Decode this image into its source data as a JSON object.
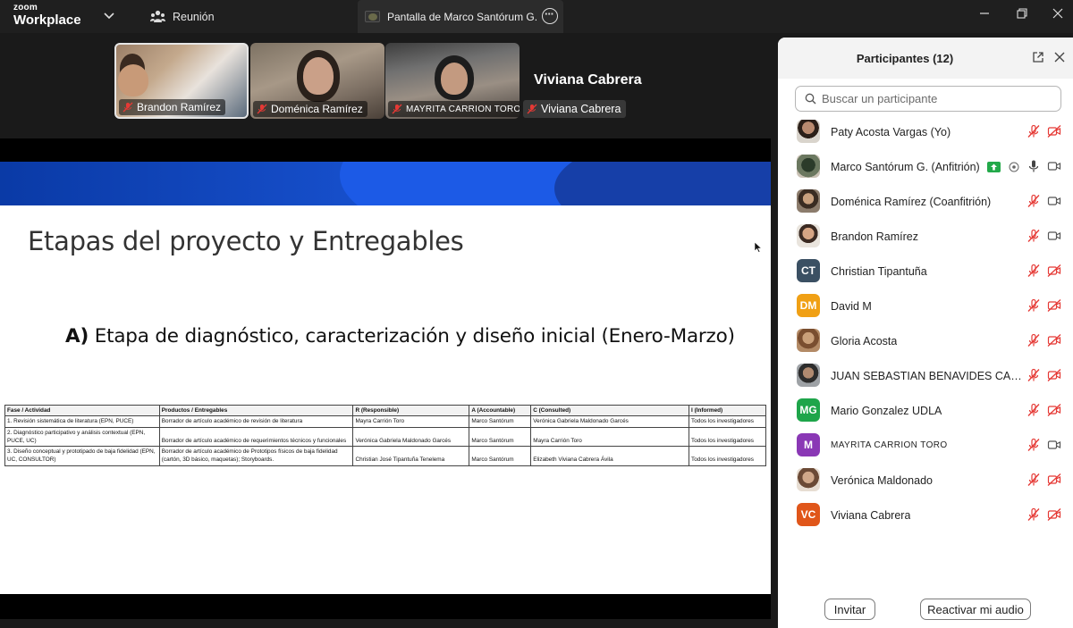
{
  "app": {
    "logo_line1": "zoom",
    "logo_line2": "Workplace",
    "meeting_tab_label": "Reunión",
    "share_tab_label": "Pantalla de Marco Santórum G."
  },
  "videos": [
    {
      "name": "Brandon Ramírez",
      "muted": true
    },
    {
      "name": "Doménica Ramírez",
      "muted": true
    },
    {
      "name": "MAYRITA CARRION TORO",
      "muted": true
    },
    {
      "name": "Viviana Cabrera",
      "muted": true
    }
  ],
  "active_speaker_name": "Viviana Cabrera",
  "slide": {
    "title": "Etapas del proyecto y Entregables",
    "subtitle_prefix": "A)",
    "subtitle": "Etapa de diagnóstico, caracterización y diseño inicial (Enero-Marzo)",
    "table": {
      "headers": [
        "Fase / Actividad",
        "Productos / Entregables",
        "R (Responsible)",
        "A (Accountable)",
        "C (Consulted)",
        "I (Informed)"
      ],
      "rows": [
        [
          "1. Revisión sistemática de literatura (EPN, PUCE)",
          "Borrador de artículo académico de revisión de literatura",
          "Mayra Carrión Toro",
          "Marco Santórum",
          "Verónica Gabriela Maldonado Garcés",
          "Todos los investigadores"
        ],
        [
          "2. Diagnóstico participativo y análisis contextual (EPN, PUCE, UC)",
          "Borrador de artículo académico de requerimientos técnicos y funcionales",
          "Verónica Gabriela Maldonado Garcés",
          "Marco Santórum",
          "Mayra Carrión Toro",
          "Todos los investigadores"
        ],
        [
          "3. Diseño conceptual y prototipado de baja fidelidad (EPN, UC, CONSULTOR)",
          "Borrador de artículo académico de Prototipos físicos de baja fidelidad (cartón, 3D básico, maquetas); Storyboards.",
          "Christian José Tipantuña Tenelema",
          "Marco Santórum",
          "Elizabeth Viviana Cabrera Ávila",
          "Todos los investigadores"
        ]
      ]
    }
  },
  "panel": {
    "title": "Participantes (12)",
    "search_placeholder": "Buscar un participante",
    "invite_label": "Invitar",
    "reactivate_label": "Reactivar mi audio",
    "participants": [
      {
        "name": "Paty Acosta Vargas (Yo)",
        "avatar": "photo",
        "mic": "muted",
        "cam": "off"
      },
      {
        "name": "Marco Santórum G. (Anfitrión)",
        "avatar": "photo",
        "mic": "on",
        "cam": "on",
        "sharing": true
      },
      {
        "name": "Doménica Ramírez (Coanfitrión)",
        "avatar": "photo",
        "mic": "muted",
        "cam": "on"
      },
      {
        "name": "Brandon Ramírez",
        "avatar": "photo",
        "mic": "muted",
        "cam": "on"
      },
      {
        "name": "Christian Tipantuña",
        "avatar": "CT",
        "avatar_color": "#3b5063",
        "mic": "muted",
        "cam": "off"
      },
      {
        "name": "David M",
        "avatar": "DM",
        "avatar_color": "#f0a015",
        "mic": "muted",
        "cam": "off"
      },
      {
        "name": "Gloria Acosta",
        "avatar": "photo",
        "mic": "muted",
        "cam": "off"
      },
      {
        "name": "JUAN SEBASTIAN BENAVIDES CARDE...",
        "avatar": "photo",
        "mic": "muted",
        "cam": "off"
      },
      {
        "name": "Mario Gonzalez UDLA",
        "avatar": "MG",
        "avatar_color": "#1ea54a",
        "mic": "muted",
        "cam": "off"
      },
      {
        "name": "MAYRITA CARRION TORO",
        "avatar": "M",
        "avatar_color": "#8a38b5",
        "mic": "muted",
        "cam": "on"
      },
      {
        "name": "Verónica Maldonado",
        "avatar": "photo",
        "mic": "muted",
        "cam": "off"
      },
      {
        "name": "Viviana Cabrera",
        "avatar": "VC",
        "avatar_color": "#e0561a",
        "mic": "muted",
        "cam": "off"
      }
    ]
  }
}
